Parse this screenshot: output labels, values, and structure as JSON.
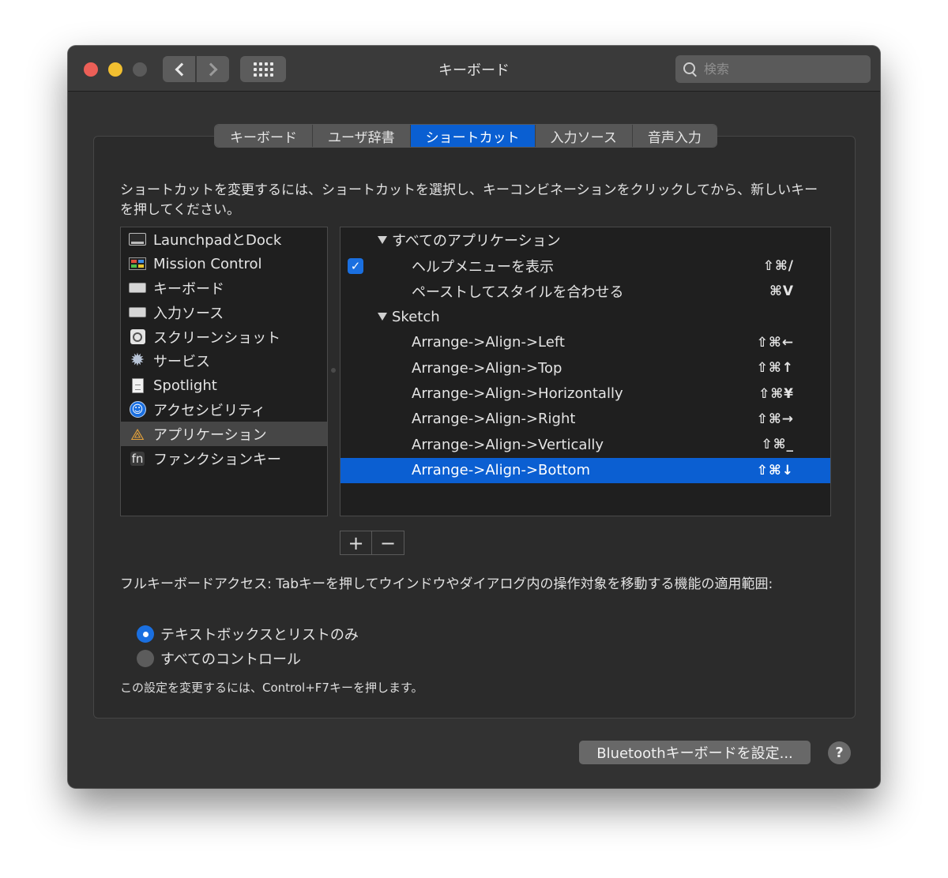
{
  "window": {
    "title": "キーボード"
  },
  "search": {
    "placeholder": "検索"
  },
  "tabs": [
    {
      "label": "キーボード",
      "active": false
    },
    {
      "label": "ユーザ辞書",
      "active": false
    },
    {
      "label": "ショートカット",
      "active": true
    },
    {
      "label": "入力ソース",
      "active": false
    },
    {
      "label": "音声入力",
      "active": false
    }
  ],
  "instructions": "ショートカットを変更するには、ショートカットを選択し、キーコンビネーションをクリックしてから、新しいキーを押してください。",
  "categories": [
    {
      "label": "LaunchpadとDock",
      "icon": "dock-icon"
    },
    {
      "label": "Mission Control",
      "icon": "mission-control-icon"
    },
    {
      "label": "キーボード",
      "icon": "keyboard-icon"
    },
    {
      "label": "入力ソース",
      "icon": "keyboard-icon"
    },
    {
      "label": "スクリーンショット",
      "icon": "screenshot-icon"
    },
    {
      "label": "サービス",
      "icon": "gear-icon"
    },
    {
      "label": "Spotlight",
      "icon": "document-icon"
    },
    {
      "label": "アクセシビリティ",
      "icon": "accessibility-icon"
    },
    {
      "label": "アプリケーション",
      "icon": "app-store-icon",
      "selected": true
    },
    {
      "label": "ファンクションキー",
      "icon": "fn-icon",
      "icon_text": "fn"
    }
  ],
  "shortcuts": {
    "group1": {
      "label": "すべてのアプリケーション"
    },
    "items1": [
      {
        "label": "ヘルプメニューを表示",
        "keys": "⇧⌘/",
        "checked": true
      },
      {
        "label": "ペーストしてスタイルを合わせる",
        "keys": "⌘V"
      }
    ],
    "group2": {
      "label": "Sketch"
    },
    "items2": [
      {
        "label": "Arrange->Align->Left",
        "keys": "⇧⌘←"
      },
      {
        "label": "Arrange->Align->Top",
        "keys": "⇧⌘↑"
      },
      {
        "label": "Arrange->Align->Horizontally",
        "keys": "⇧⌘¥"
      },
      {
        "label": "Arrange->Align->Right",
        "keys": "⇧⌘→"
      },
      {
        "label": "Arrange->Align->Vertically",
        "keys": "⇧⌘_"
      },
      {
        "label": "Arrange->Align->Bottom",
        "keys": "⇧⌘↓",
        "selected": true
      }
    ]
  },
  "buttons": {
    "add": "+",
    "remove": "−",
    "bluetooth": "Bluetoothキーボードを設定...",
    "help": "?"
  },
  "full_keyboard_access": {
    "label": "フルキーボードアクセス: Tabキーを押してウインドウやダイアログ内の操作対象を移動する機能の適用範囲:",
    "options": [
      {
        "label": "テキストボックスとリストのみ",
        "selected": true
      },
      {
        "label": "すべてのコントロール",
        "selected": false
      }
    ],
    "note": "この設定を変更するには、Control+F7キーを押します。"
  },
  "colors": {
    "accent": "#0b5fd2",
    "window_bg": "#323232",
    "list_bg": "#1f1f1f"
  }
}
